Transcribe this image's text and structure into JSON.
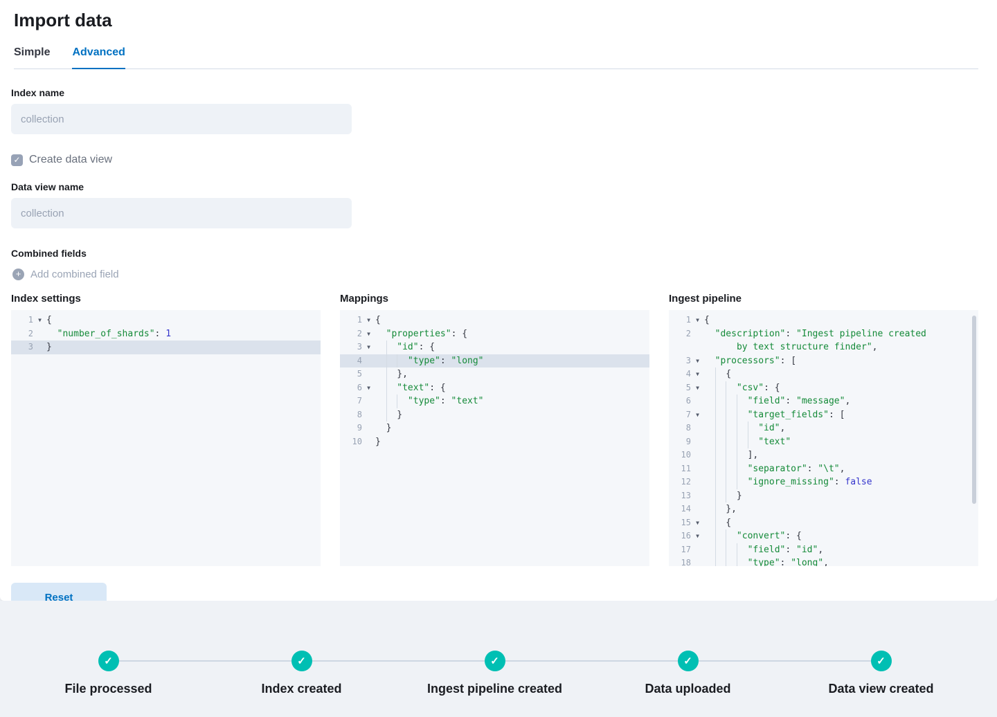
{
  "page": {
    "title": "Import data"
  },
  "tabs": [
    {
      "label": "Simple",
      "active": false
    },
    {
      "label": "Advanced",
      "active": true
    }
  ],
  "form": {
    "index_name_label": "Index name",
    "index_name_value": "collection",
    "create_data_view_label": "Create data view",
    "create_data_view_checked": true,
    "data_view_name_label": "Data view name",
    "data_view_name_value": "collection",
    "combined_fields_label": "Combined fields",
    "add_combined_field_label": "Add combined field",
    "reset_label": "Reset"
  },
  "colors": {
    "accent_blue": "#0071C2",
    "success_teal": "#00BFB3",
    "code_string_green": "#148A38",
    "code_literal_blue": "#3434CC",
    "line_highlight": "#DBE2EC",
    "editor_background": "#F5F7FA"
  },
  "editors": [
    {
      "title": "Index settings",
      "scrollbar": false,
      "lines": [
        {
          "n": "1",
          "fold": true,
          "hl": false,
          "ind": 0,
          "g": 0,
          "tk": [
            [
              "{",
              "p"
            ]
          ]
        },
        {
          "n": "2",
          "fold": false,
          "hl": false,
          "ind": 1,
          "g": 0,
          "tk": [
            [
              "\"number_of_shards\"",
              "s"
            ],
            [
              ": ",
              "p"
            ],
            [
              "1",
              "n"
            ]
          ]
        },
        {
          "n": "3",
          "fold": false,
          "hl": true,
          "ind": 0,
          "g": 0,
          "tk": [
            [
              "}",
              "p"
            ]
          ]
        }
      ]
    },
    {
      "title": "Mappings",
      "scrollbar": false,
      "lines": [
        {
          "n": "1",
          "fold": true,
          "hl": false,
          "ind": 0,
          "g": 0,
          "tk": [
            [
              "{",
              "p"
            ]
          ]
        },
        {
          "n": "2",
          "fold": true,
          "hl": false,
          "ind": 1,
          "g": 0,
          "tk": [
            [
              "\"properties\"",
              "s"
            ],
            [
              ": {",
              "p"
            ]
          ]
        },
        {
          "n": "3",
          "fold": true,
          "hl": false,
          "ind": 2,
          "g": 1,
          "tk": [
            [
              "\"id\"",
              "s"
            ],
            [
              ": {",
              "p"
            ]
          ]
        },
        {
          "n": "4",
          "fold": false,
          "hl": true,
          "ind": 3,
          "g": 2,
          "tk": [
            [
              "\"type\"",
              "s"
            ],
            [
              ": ",
              "p"
            ],
            [
              "\"long\"",
              "s"
            ]
          ]
        },
        {
          "n": "5",
          "fold": false,
          "hl": false,
          "ind": 2,
          "g": 1,
          "tk": [
            [
              "},",
              "p"
            ]
          ]
        },
        {
          "n": "6",
          "fold": true,
          "hl": false,
          "ind": 2,
          "g": 1,
          "tk": [
            [
              "\"text\"",
              "s"
            ],
            [
              ": {",
              "p"
            ]
          ]
        },
        {
          "n": "7",
          "fold": false,
          "hl": false,
          "ind": 3,
          "g": 2,
          "tk": [
            [
              "\"type\"",
              "s"
            ],
            [
              ": ",
              "p"
            ],
            [
              "\"text\"",
              "s"
            ]
          ]
        },
        {
          "n": "8",
          "fold": false,
          "hl": false,
          "ind": 2,
          "g": 1,
          "tk": [
            [
              "}",
              "p"
            ]
          ]
        },
        {
          "n": "9",
          "fold": false,
          "hl": false,
          "ind": 1,
          "g": 0,
          "tk": [
            [
              "}",
              "p"
            ]
          ]
        },
        {
          "n": "10",
          "fold": false,
          "hl": false,
          "ind": 0,
          "g": 0,
          "tk": [
            [
              "}",
              "p"
            ]
          ]
        }
      ]
    },
    {
      "title": "Ingest pipeline",
      "scrollbar": true,
      "lines": [
        {
          "n": "1",
          "fold": true,
          "hl": false,
          "ind": 0,
          "g": 0,
          "tk": [
            [
              "{",
              "p"
            ]
          ]
        },
        {
          "n": "2",
          "fold": false,
          "hl": false,
          "ind": 1,
          "g": 0,
          "tk": [
            [
              "\"description\"",
              "s"
            ],
            [
              ": ",
              "p"
            ],
            [
              "\"Ingest pipeline created",
              "s"
            ]
          ]
        },
        {
          "n": "",
          "fold": false,
          "hl": false,
          "ind": 3,
          "g": 0,
          "tk": [
            [
              "by text structure finder\"",
              "s"
            ],
            [
              ",",
              "p"
            ]
          ]
        },
        {
          "n": "3",
          "fold": true,
          "hl": false,
          "ind": 1,
          "g": 0,
          "tk": [
            [
              "\"processors\"",
              "s"
            ],
            [
              ": [",
              "p"
            ]
          ]
        },
        {
          "n": "4",
          "fold": true,
          "hl": false,
          "ind": 2,
          "g": 1,
          "tk": [
            [
              "{",
              "p"
            ]
          ]
        },
        {
          "n": "5",
          "fold": true,
          "hl": false,
          "ind": 3,
          "g": 2,
          "tk": [
            [
              "\"csv\"",
              "s"
            ],
            [
              ": {",
              "p"
            ]
          ]
        },
        {
          "n": "6",
          "fold": false,
          "hl": false,
          "ind": 4,
          "g": 3,
          "tk": [
            [
              "\"field\"",
              "s"
            ],
            [
              ": ",
              "p"
            ],
            [
              "\"message\"",
              "s"
            ],
            [
              ",",
              "p"
            ]
          ]
        },
        {
          "n": "7",
          "fold": true,
          "hl": false,
          "ind": 4,
          "g": 3,
          "tk": [
            [
              "\"target_fields\"",
              "s"
            ],
            [
              ": [",
              "p"
            ]
          ]
        },
        {
          "n": "8",
          "fold": false,
          "hl": false,
          "ind": 5,
          "g": 4,
          "tk": [
            [
              "\"id\"",
              "s"
            ],
            [
              ",",
              "p"
            ]
          ]
        },
        {
          "n": "9",
          "fold": false,
          "hl": false,
          "ind": 5,
          "g": 4,
          "tk": [
            [
              "\"text\"",
              "s"
            ]
          ]
        },
        {
          "n": "10",
          "fold": false,
          "hl": false,
          "ind": 4,
          "g": 3,
          "tk": [
            [
              "],",
              "p"
            ]
          ]
        },
        {
          "n": "11",
          "fold": false,
          "hl": false,
          "ind": 4,
          "g": 3,
          "tk": [
            [
              "\"separator\"",
              "s"
            ],
            [
              ": ",
              "p"
            ],
            [
              "\"\\t\"",
              "s"
            ],
            [
              ",",
              "p"
            ]
          ]
        },
        {
          "n": "12",
          "fold": false,
          "hl": false,
          "ind": 4,
          "g": 3,
          "tk": [
            [
              "\"ignore_missing\"",
              "s"
            ],
            [
              ": ",
              "p"
            ],
            [
              "false",
              "b"
            ]
          ]
        },
        {
          "n": "13",
          "fold": false,
          "hl": false,
          "ind": 3,
          "g": 2,
          "tk": [
            [
              "}",
              "p"
            ]
          ]
        },
        {
          "n": "14",
          "fold": false,
          "hl": false,
          "ind": 2,
          "g": 1,
          "tk": [
            [
              "},",
              "p"
            ]
          ]
        },
        {
          "n": "15",
          "fold": true,
          "hl": false,
          "ind": 2,
          "g": 1,
          "tk": [
            [
              "{",
              "p"
            ]
          ]
        },
        {
          "n": "16",
          "fold": true,
          "hl": false,
          "ind": 3,
          "g": 2,
          "tk": [
            [
              "\"convert\"",
              "s"
            ],
            [
              ": {",
              "p"
            ]
          ]
        },
        {
          "n": "17",
          "fold": false,
          "hl": false,
          "ind": 4,
          "g": 3,
          "tk": [
            [
              "\"field\"",
              "s"
            ],
            [
              ": ",
              "p"
            ],
            [
              "\"id\"",
              "s"
            ],
            [
              ",",
              "p"
            ]
          ]
        },
        {
          "n": "18",
          "fold": false,
          "hl": false,
          "ind": 4,
          "g": 3,
          "tk": [
            [
              "\"type\"",
              "s"
            ],
            [
              ": ",
              "p"
            ],
            [
              "\"long\"",
              "s"
            ],
            [
              ",",
              "p"
            ]
          ]
        }
      ]
    }
  ],
  "stepper": {
    "steps": [
      {
        "label": "File processed",
        "status": "complete"
      },
      {
        "label": "Index created",
        "status": "complete"
      },
      {
        "label": "Ingest pipeline created",
        "status": "complete"
      },
      {
        "label": "Data uploaded",
        "status": "complete"
      },
      {
        "label": "Data view created",
        "status": "complete"
      }
    ]
  }
}
